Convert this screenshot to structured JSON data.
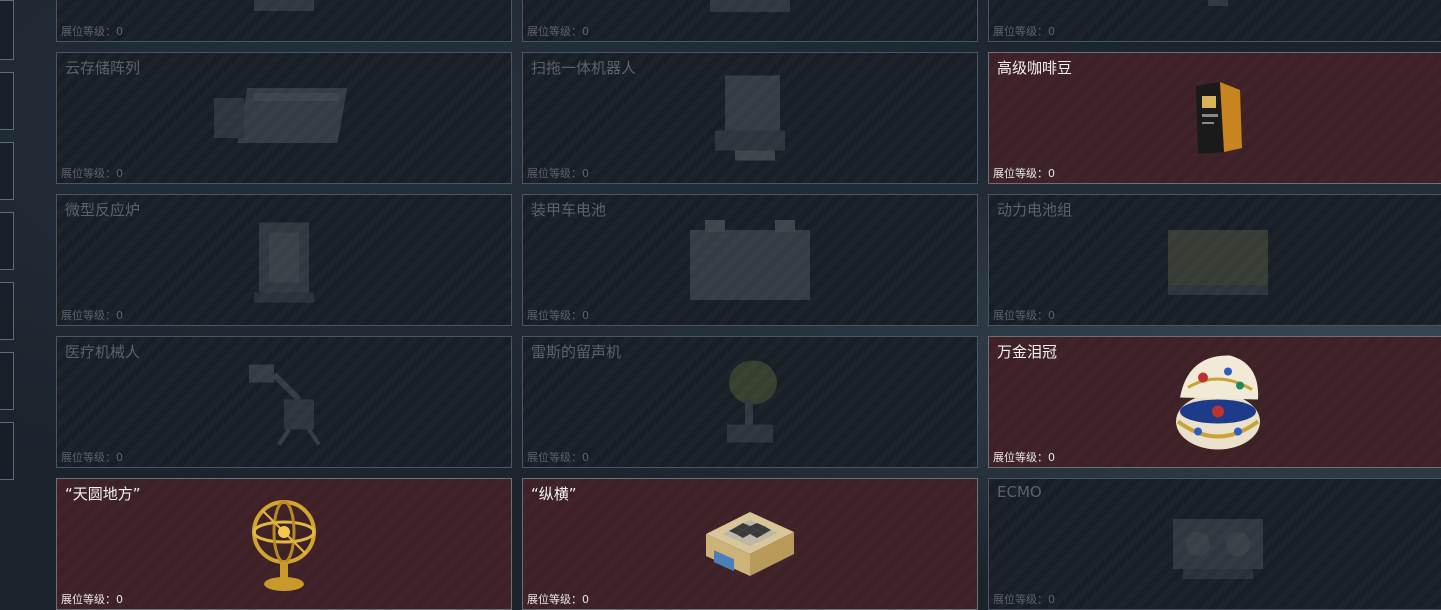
{
  "level_label": "展位等级：",
  "cards": [
    {
      "title": "",
      "level": "0",
      "owned": false,
      "icon": "machine-icon"
    },
    {
      "title": "",
      "level": "0",
      "owned": false,
      "icon": "device-icon"
    },
    {
      "title": "",
      "level": "0",
      "owned": false,
      "icon": "device-icon"
    },
    {
      "title": "云存储阵列",
      "level": "0",
      "owned": false,
      "icon": "server-array-icon"
    },
    {
      "title": "扫拖一体机器人",
      "level": "0",
      "owned": false,
      "icon": "robot-vacuum-icon"
    },
    {
      "title": "高级咖啡豆",
      "level": "0",
      "owned": true,
      "icon": "coffee-bag-icon"
    },
    {
      "title": "微型反应炉",
      "level": "0",
      "owned": false,
      "icon": "reactor-icon"
    },
    {
      "title": "装甲车电池",
      "level": "0",
      "owned": false,
      "icon": "battery-icon"
    },
    {
      "title": "动力电池组",
      "level": "0",
      "owned": false,
      "icon": "battery-pack-icon"
    },
    {
      "title": "医疗机械人",
      "level": "0",
      "owned": false,
      "icon": "medical-robot-icon"
    },
    {
      "title": "雷斯的留声机",
      "level": "0",
      "owned": false,
      "icon": "gramophone-icon"
    },
    {
      "title": "万金泪冠",
      "level": "0",
      "owned": true,
      "icon": "jeweled-egg-icon"
    },
    {
      "title": "“天圆地方”",
      "level": "0",
      "owned": true,
      "icon": "armillary-sphere-icon"
    },
    {
      "title": "“纵横”",
      "level": "0",
      "owned": true,
      "icon": "chess-box-icon"
    },
    {
      "title": "ECMO",
      "level": "0",
      "owned": false,
      "icon": "ecmo-machine-icon"
    }
  ]
}
